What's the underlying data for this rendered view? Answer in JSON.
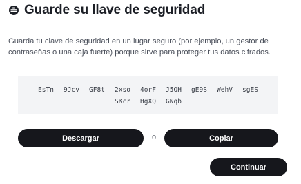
{
  "header": {
    "icon": "key-icon",
    "title": "Guarde su llave de seguridad"
  },
  "description": "Guarda tu clave de seguridad en un lugar seguro (por ejemplo, un gestor de contraseñas o una caja fuerte) porque sirve para proteger tus datos cifrados.",
  "recovery_key": {
    "words": [
      "EsTn",
      "9Jcv",
      "GF8t",
      "2xso",
      "4orF",
      "J5QH",
      "gE9S",
      "WehV",
      "sgES",
      "SKcr",
      "HgXQ",
      "GNqb"
    ]
  },
  "actions": {
    "download_label": "Descargar",
    "separator": "o",
    "copy_label": "Copiar",
    "continue_label": "Continuar"
  },
  "colors": {
    "button_bg": "#16171c",
    "key_box_bg": "#f3f4f6",
    "text": "#1c1f26"
  }
}
